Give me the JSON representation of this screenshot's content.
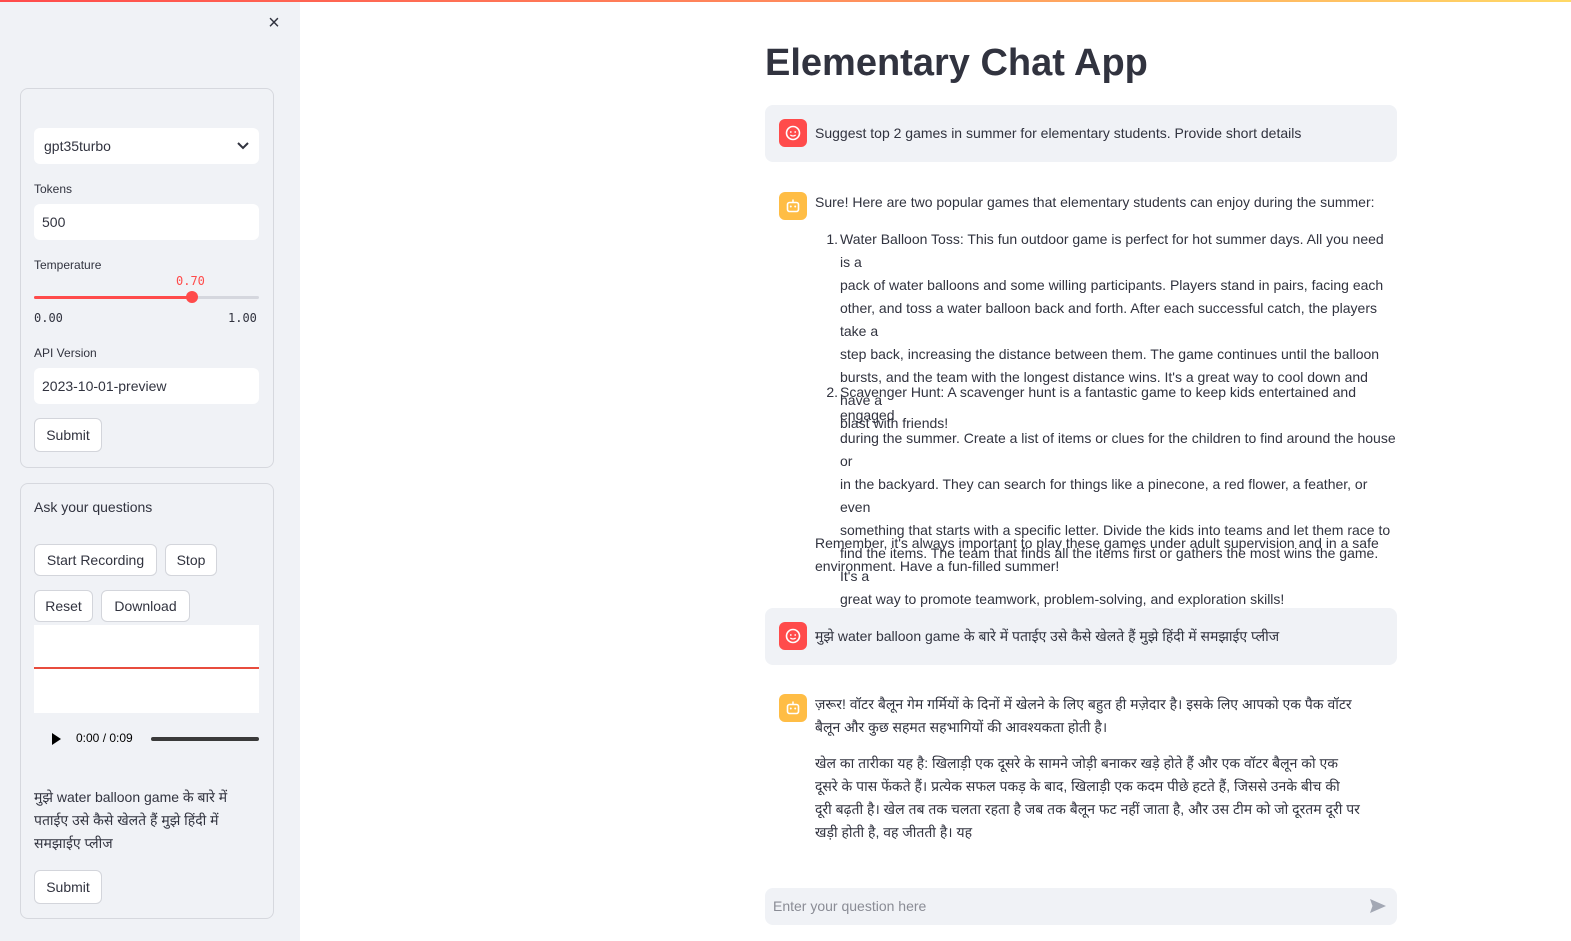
{
  "sidebar": {
    "close_icon": "×",
    "model_select": {
      "value": "gpt35turbo",
      "chevron": "⌄"
    },
    "tokens": {
      "label": "Tokens",
      "value": "500"
    },
    "temperature": {
      "label": "Temperature",
      "value_label": "0.70",
      "value": 0.7,
      "min_label": "0.00",
      "max_label": "1.00",
      "min": 0,
      "max": 1
    },
    "api_version": {
      "label": "API Version",
      "value": "2023-10-01-preview"
    },
    "submit_label": "Submit",
    "questions": {
      "label": "Ask your questions",
      "start_recording": "Start Recording",
      "stop": "Stop",
      "reset": "Reset",
      "download": "Download",
      "audio_time": "0:00 / 0:09",
      "transcript": "मुझे water balloon game के बारे में पताईए उसे कैसे खेलते हैं मुझे हिंदी में समझाईए प्लीज",
      "submit_label": "Submit"
    }
  },
  "main": {
    "title": "Elementary Chat App",
    "messages": {
      "user1": "Suggest top 2 games in summer for elementary students. Provide short details",
      "bot1_intro": "Sure! Here are two popular games that elementary students can enjoy during the summer:",
      "bot1_item1_num": "1.",
      "bot1_item1_lines": [
        "Water Balloon Toss: This fun outdoor game is perfect for hot summer days. All you need is a",
        "pack of water balloons and some willing participants. Players stand in pairs, facing each",
        "other, and toss a water balloon back and forth. After each successful catch, the players take a",
        "step back, increasing the distance between them. The game continues until the balloon",
        "bursts, and the team with the longest distance wins. It's a great way to cool down and have a",
        "blast with friends!"
      ],
      "bot1_item2_num": "2.",
      "bot1_item2_lines": [
        "Scavenger Hunt: A scavenger hunt is a fantastic game to keep kids entertained and engaged",
        "during the summer. Create a list of items or clues for the children to find around the house or",
        "in the backyard. They can search for things like a pinecone, a red flower, a feather, or even",
        "something that starts with a specific letter. Divide the kids into teams and let them race to",
        "find the items. The team that finds all the items first or gathers the most wins the game. It's a",
        "great way to promote teamwork, problem-solving, and exploration skills!"
      ],
      "bot1_outro_lines": [
        "Remember, it's always important to play these games under adult supervision and in a safe",
        "environment. Have a fun-filled summer!"
      ],
      "user2": "मुझे water balloon game के बारे में पताईए उसे कैसे खेलते हैं मुझे हिंदी में समझाईए प्लीज",
      "bot2_p1_lines": [
        "ज़रूर! वॉटर बैलून गेम गर्मियों के दिनों में खेलने के लिए बहुत ही मज़ेदार है। इसके लिए आपको एक पैक वॉटर",
        "बैलून और कुछ सहमत सहभागियों की आवश्यकता होती है।"
      ],
      "bot2_p2_lines": [
        "खेल का तारीका यह है: खिलाड़ी एक दूसरे के सामने जोड़ी बनाकर खड़े होते हैं और एक वॉटर बैलून को एक",
        "दूसरे के पास फेंकते हैं। प्रत्येक सफल पकड़ के बाद, खिलाड़ी एक कदम पीछे हटते हैं, जिससे उनके बीच की",
        "दूरी बढ़ती है। खेल तब तक चलता रहता है जब तक बैलून फट नहीं जाता है, और उस टीम को जो दूरतम दूरी पर",
        "खड़ी होती है, वह जीतती है। यह"
      ]
    },
    "chat_input": {
      "placeholder": "Enter your question here",
      "send_icon": "send-icon"
    }
  },
  "colors": {
    "accent": "#ff4b4b",
    "user_avatar": "#ff4b4b",
    "bot_avatar": "#ffbd45",
    "sidebar_bg": "#f0f2f6"
  }
}
